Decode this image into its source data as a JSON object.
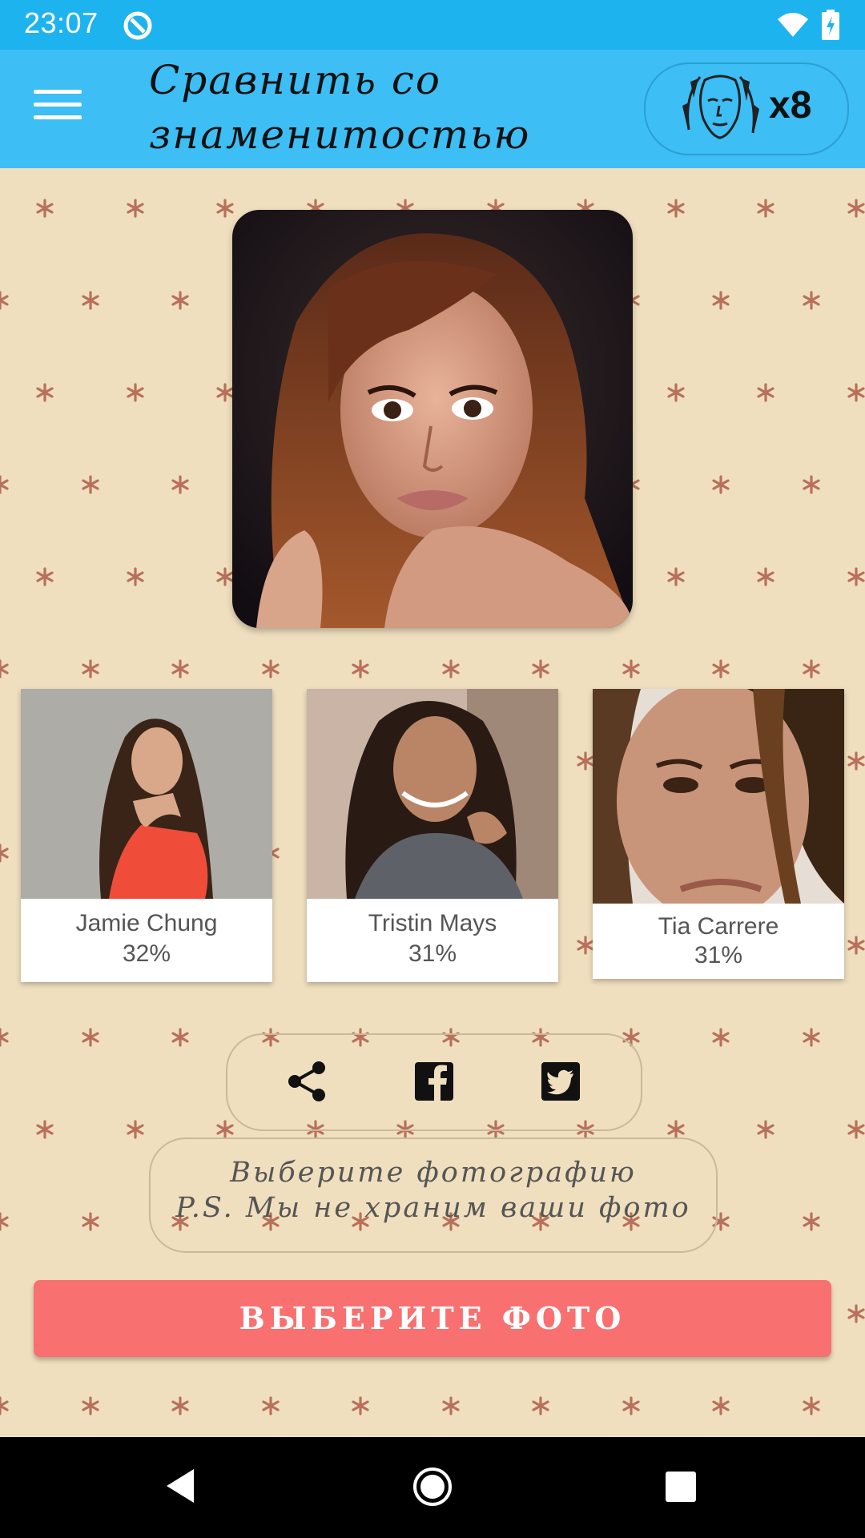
{
  "status_bar": {
    "time": "23:07",
    "icons": [
      "app-notification-icon",
      "wifi-icon",
      "battery-charging-icon"
    ]
  },
  "app_bar": {
    "title": "Сравнить со знаменитостью",
    "credits_count": "x8",
    "icons": [
      "menu-icon",
      "celebrity-face-icon"
    ]
  },
  "main_photo": {
    "description_icon": "user-selected-photo"
  },
  "matches": [
    {
      "name": "Jamie Chung",
      "percent": "32%"
    },
    {
      "name": "Tristin Mays",
      "percent": "31%"
    },
    {
      "name": "Tia Carrere",
      "percent": "31%"
    }
  ],
  "share": {
    "icons": [
      "share-icon",
      "facebook-icon",
      "twitter-icon"
    ]
  },
  "info": {
    "line1": "Выберите фотографию",
    "line2": "P.S. Мы не храним ваши фото"
  },
  "pick_button": {
    "label": "ВЫБЕРИТЕ ФОТО"
  },
  "colors": {
    "status_bar": "#1DB3EE",
    "app_bar": "#3DBEF4",
    "background": "#EFDFBE",
    "pattern_star": "#B8705A",
    "button": "#F87070"
  },
  "nav_bar": {
    "icons": [
      "back-icon",
      "home-icon",
      "recents-icon"
    ]
  }
}
